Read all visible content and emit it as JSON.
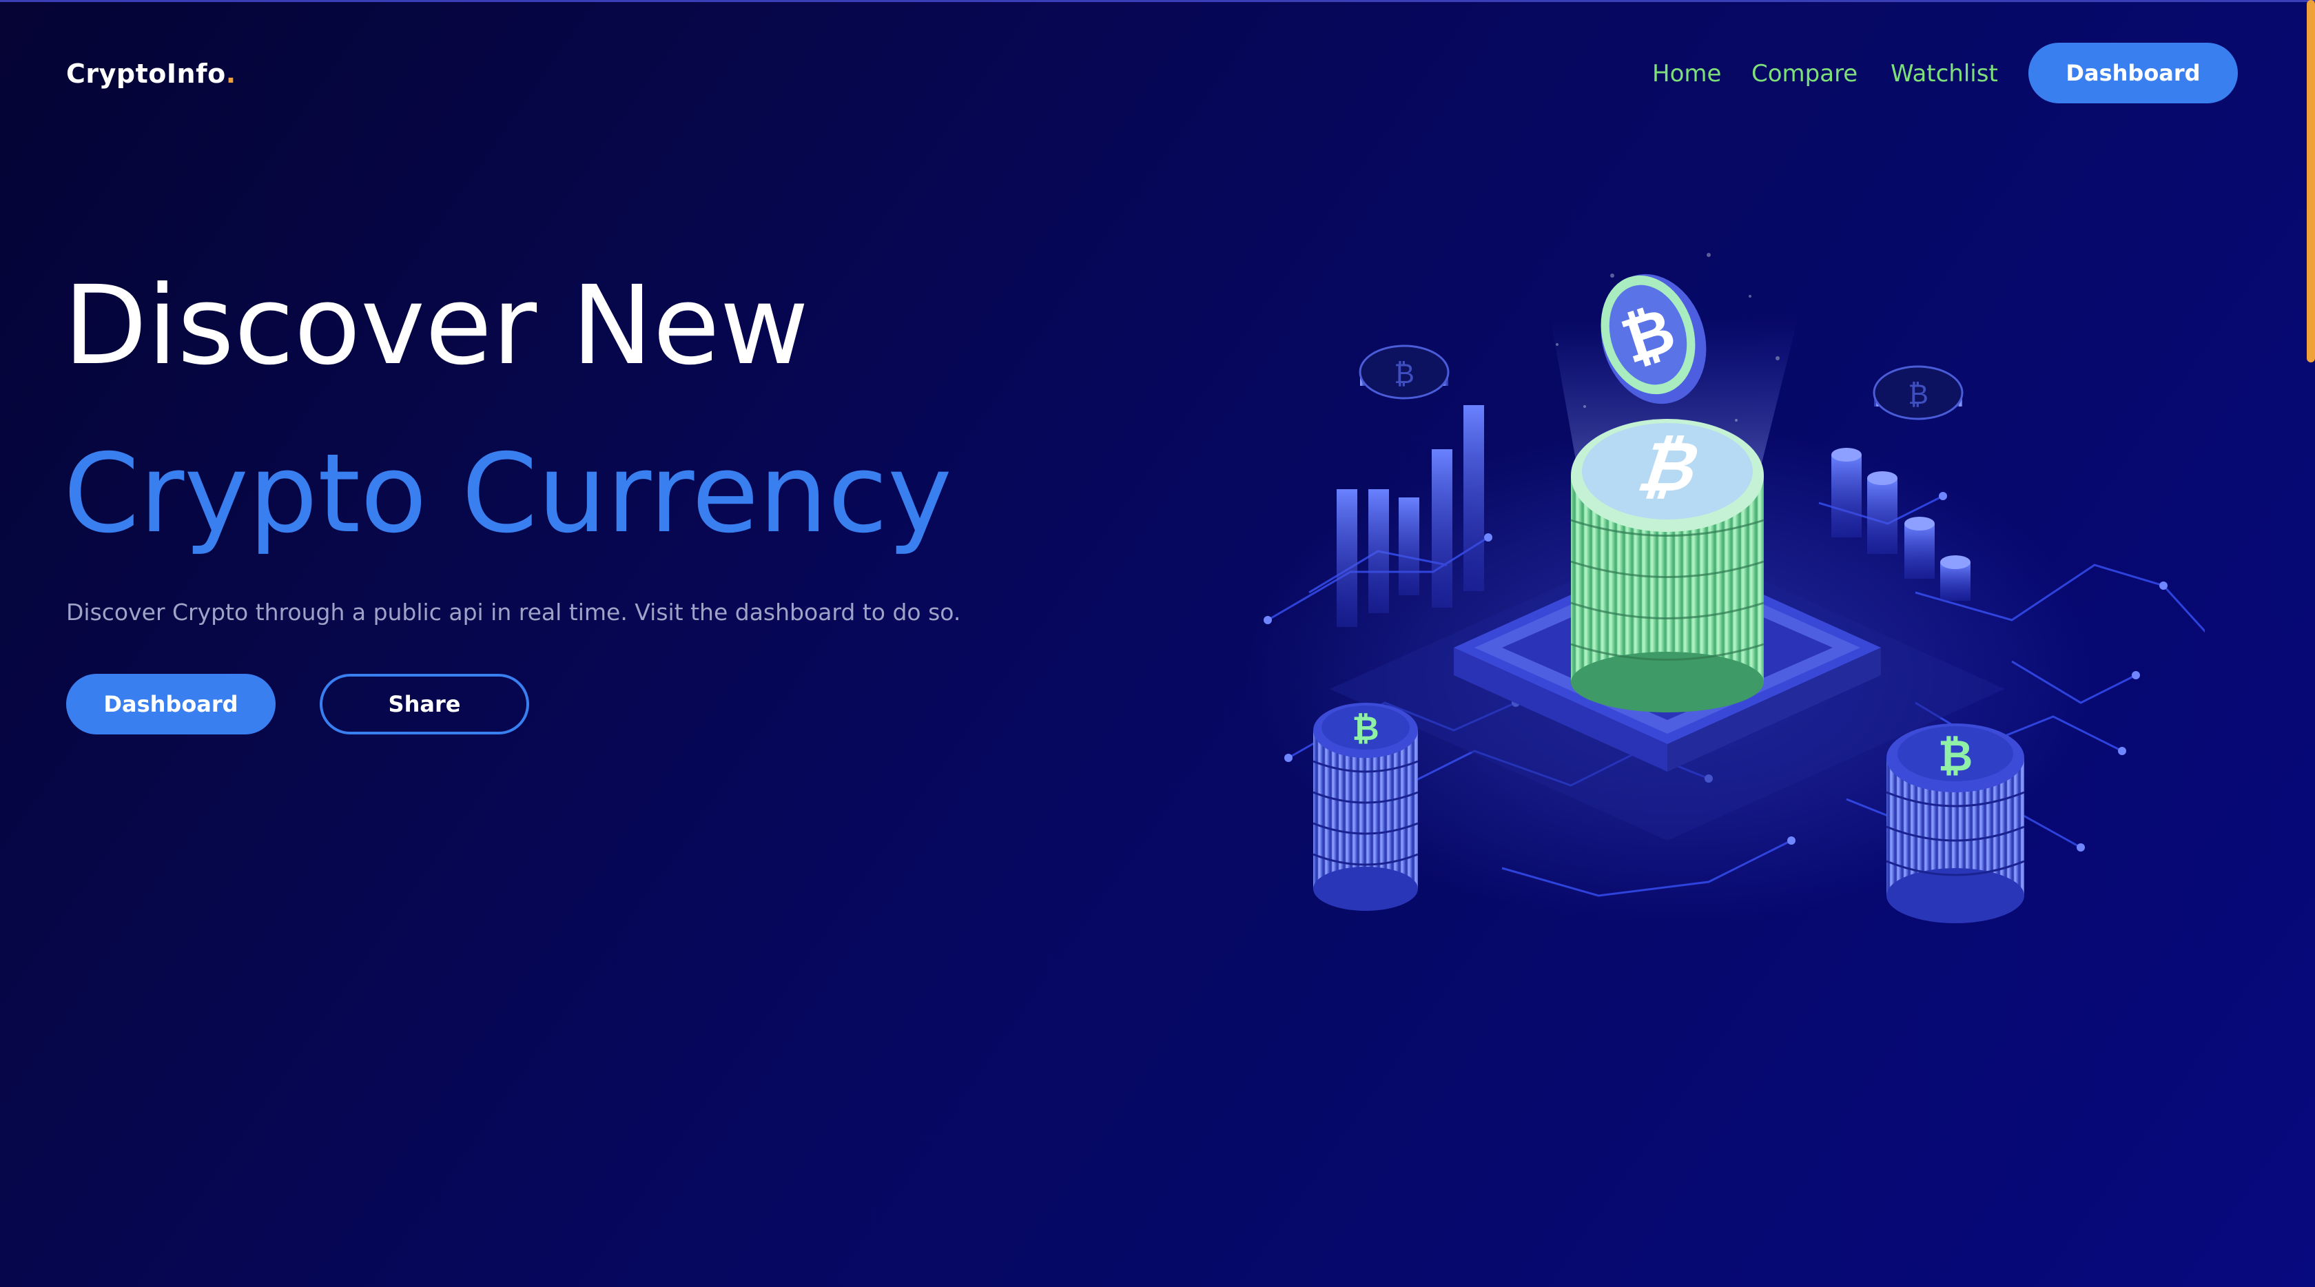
{
  "app": {
    "logo_text": "CryptoInfo",
    "logo_dot": ".",
    "accent_color": "#3a7ff0",
    "nav_link_color": "#7ee07a",
    "logo_dot_color": "#f0a23a"
  },
  "nav": {
    "links": [
      {
        "label": "Home"
      },
      {
        "label": "Compare"
      },
      {
        "label": "Watchlist"
      }
    ],
    "cta_label": "Dashboard"
  },
  "hero": {
    "title_line1": "Discover New",
    "title_line2": "Crypto Currency",
    "description": "Discover Crypto through a public api in real time. Visit the dashboard to do so.",
    "primary_button": "Dashboard",
    "secondary_button": "Share"
  },
  "illustration": {
    "icon": "bitcoin-isometric-illustration"
  }
}
